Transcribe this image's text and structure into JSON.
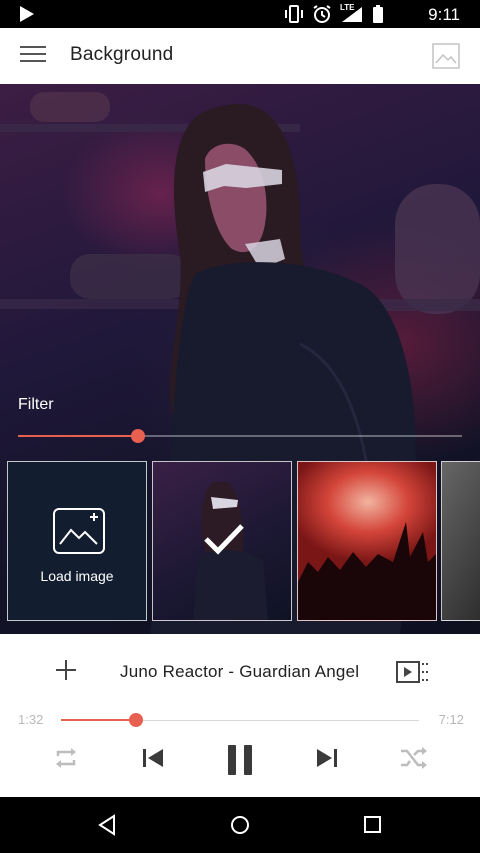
{
  "status_bar": {
    "time": "9:11",
    "network_label": "LTE",
    "icons": [
      "play-icon",
      "vibrate-icon",
      "alarm-icon",
      "signal-icon",
      "battery-icon"
    ]
  },
  "toolbar": {
    "title": "Background",
    "icons": [
      "menu-icon",
      "image-icon"
    ]
  },
  "background": {
    "filter_label": "Filter",
    "filter_level": 0.27,
    "thumbnails": [
      {
        "type": "load",
        "label": "Load image",
        "icon": "add-image-icon"
      },
      {
        "type": "image",
        "selected": true,
        "icon": "checkmark-icon"
      },
      {
        "type": "image",
        "selected": false
      },
      {
        "type": "image",
        "selected": false
      }
    ]
  },
  "player": {
    "track_title": "Juno Reactor - Guardian Angel",
    "current_time": "1:32",
    "total_time": "7:12",
    "progress": 0.21,
    "icons": [
      "add-icon",
      "playlist-video-icon",
      "repeat-icon",
      "skip-previous-icon",
      "pause-icon",
      "skip-next-icon",
      "shuffle-icon"
    ]
  },
  "nav_bar": {
    "icons": [
      "back-icon",
      "home-icon",
      "recents-icon"
    ]
  },
  "colors": {
    "accent": "#e8604f",
    "toolbar_bg": "#ffffff",
    "thumb_load_bg": "#121d30"
  }
}
